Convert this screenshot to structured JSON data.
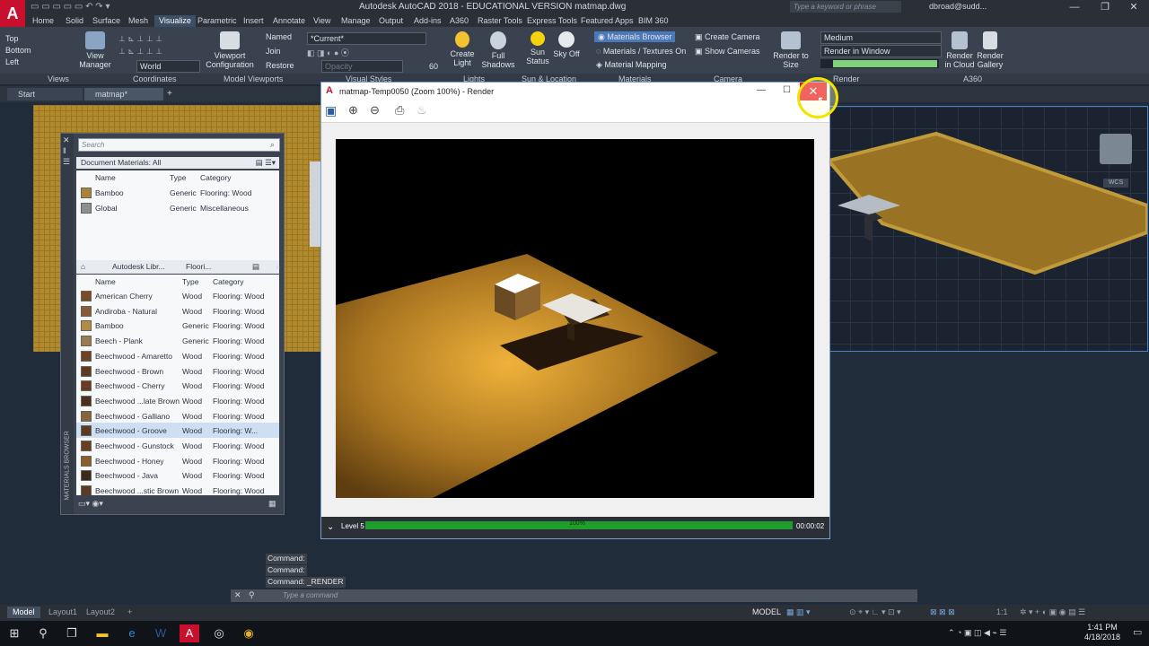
{
  "app": {
    "title": "Autodesk AutoCAD 2018 - EDUCATIONAL VERSION    matmap.dwg",
    "search_placeholder": "Type a keyword or phrase",
    "user": "dbroad@sudd...",
    "logo_letter": "A"
  },
  "menu_tabs": [
    "Home",
    "Solid",
    "Surface",
    "Mesh",
    "Visualize",
    "Parametric",
    "Insert",
    "Annotate",
    "View",
    "Manage",
    "Output",
    "Add-ins",
    "A360",
    "Raster Tools",
    "Express Tools",
    "Featured Apps",
    "BIM 360"
  ],
  "active_tab": "Visualize",
  "ribbon": {
    "views_list": [
      "Top",
      "Bottom",
      "Left"
    ],
    "view_manager": "View Manager",
    "coord_world": "World",
    "viewport_config": "Viewport Configuration",
    "named": "Named",
    "join": "Join",
    "restore": "Restore",
    "visual_style": "*Current*",
    "opacity_placeholder": "Opacity",
    "opacity_value": "60",
    "create_light": "Create Light",
    "full_shadows": "Full Shadows",
    "sun_status": "Sun Status",
    "sky_off": "Sky Off",
    "materials_browser": "Materials Browser",
    "materials_textures": "Materials / Textures On",
    "material_mapping": "Material Mapping",
    "create_camera": "Create Camera",
    "show_cameras": "Show Cameras",
    "render_to_size": "Render to Size",
    "render_quality": "Medium",
    "render_in": "Render in Window",
    "render_cloud": "Render in Cloud",
    "render_gallery": "Render Gallery",
    "panels": [
      "Views",
      "Coordinates",
      "Model Viewports",
      "Visual Styles",
      "Lights",
      "Sun & Location",
      "Materials",
      "Camera",
      "Render",
      "A360"
    ]
  },
  "file_tabs": [
    "Start",
    "matmap*"
  ],
  "materials_browser": {
    "search_placeholder": "Search",
    "doc_filter": "Document Materials: All",
    "columns": [
      "Name",
      "Type",
      "Category"
    ],
    "doc_rows": [
      {
        "name": "Bamboo",
        "type": "Generic",
        "category": "Flooring: Wood",
        "color": "#a8843a"
      },
      {
        "name": "Global",
        "type": "Generic",
        "category": "Miscellaneous",
        "color": "#8a8f94"
      }
    ],
    "library_path": [
      "Autodesk Libr...",
      "Floori..."
    ],
    "lib_rows": [
      {
        "name": "American Cherry",
        "type": "Wood",
        "category": "Flooring: Wood",
        "color": "#7a4a2a"
      },
      {
        "name": "Andiroba - Natural",
        "type": "Wood",
        "category": "Flooring: Wood",
        "color": "#8a5a36"
      },
      {
        "name": "Bamboo",
        "type": "Generic",
        "category": "Flooring: Wood",
        "color": "#b28c44"
      },
      {
        "name": "Beech - Plank",
        "type": "Generic",
        "category": "Flooring: Wood",
        "color": "#9a7a52"
      },
      {
        "name": "Beechwood - Amaretto",
        "type": "Wood",
        "category": "Flooring: Wood",
        "color": "#6e4228"
      },
      {
        "name": "Beechwood - Brown",
        "type": "Wood",
        "category": "Flooring: Wood",
        "color": "#5e3a22"
      },
      {
        "name": "Beechwood - Cherry",
        "type": "Wood",
        "category": "Flooring: Wood",
        "color": "#6a3a26"
      },
      {
        "name": "Beechwood ...late Brown",
        "type": "Wood",
        "category": "Flooring: Wood",
        "color": "#4a2e1e"
      },
      {
        "name": "Beechwood - Galliano",
        "type": "Wood",
        "category": "Flooring: Wood",
        "color": "#8a6440"
      },
      {
        "name": "Beechwood - Groove",
        "type": "Wood",
        "category": "Flooring: W...",
        "color": "#5a3a24"
      },
      {
        "name": "Beechwood - Gunstock",
        "type": "Wood",
        "category": "Flooring: Wood",
        "color": "#6a3e22"
      },
      {
        "name": "Beechwood - Honey",
        "type": "Wood",
        "category": "Flooring: Wood",
        "color": "#8a5c30"
      },
      {
        "name": "Beechwood - Java",
        "type": "Wood",
        "category": "Flooring: Wood",
        "color": "#3e2a1c"
      },
      {
        "name": "Beechwood ...stic Brown",
        "type": "Wood",
        "category": "Flooring: Wood",
        "color": "#5a3c26"
      }
    ],
    "side_label": "MATERIALS BROWSER"
  },
  "render_window": {
    "title": "matmap-Temp0050 (Zoom 100%) - Render",
    "level": "Level 5",
    "progress": "100%",
    "progress_value": 1.0,
    "time": "00:00:02"
  },
  "command": {
    "lines": [
      "Command:",
      "Command:",
      "Command: _RENDER"
    ],
    "placeholder": "Type a command"
  },
  "status": {
    "layout_tabs": [
      "Model",
      "Layout1",
      "Layout2"
    ],
    "model_label": "MODEL",
    "scale": "1:1"
  },
  "clock": {
    "time": "1:41 PM",
    "date": "4/18/2018"
  },
  "viewcube_label": "WCS"
}
